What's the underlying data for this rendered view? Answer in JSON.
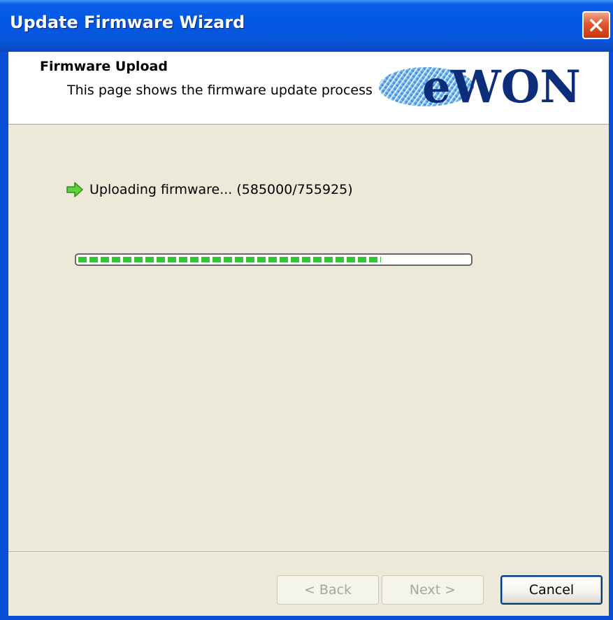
{
  "window": {
    "title": "Update Firmware Wizard"
  },
  "header": {
    "title": "Firmware Upload",
    "subtitle": "This page shows the firmware update process",
    "logo_text": "eWON"
  },
  "status": {
    "text": "Uploading firmware... (585000/755925)",
    "icon": "green-arrow-icon"
  },
  "progress": {
    "current": 585000,
    "total": 755925,
    "fraction": 0.774
  },
  "buttons": {
    "back": "< Back",
    "next": "Next >",
    "cancel": "Cancel"
  },
  "colors": {
    "titlebar": "#0058e6",
    "progress_fill": "#38c33a",
    "background": "#ece9d8"
  }
}
